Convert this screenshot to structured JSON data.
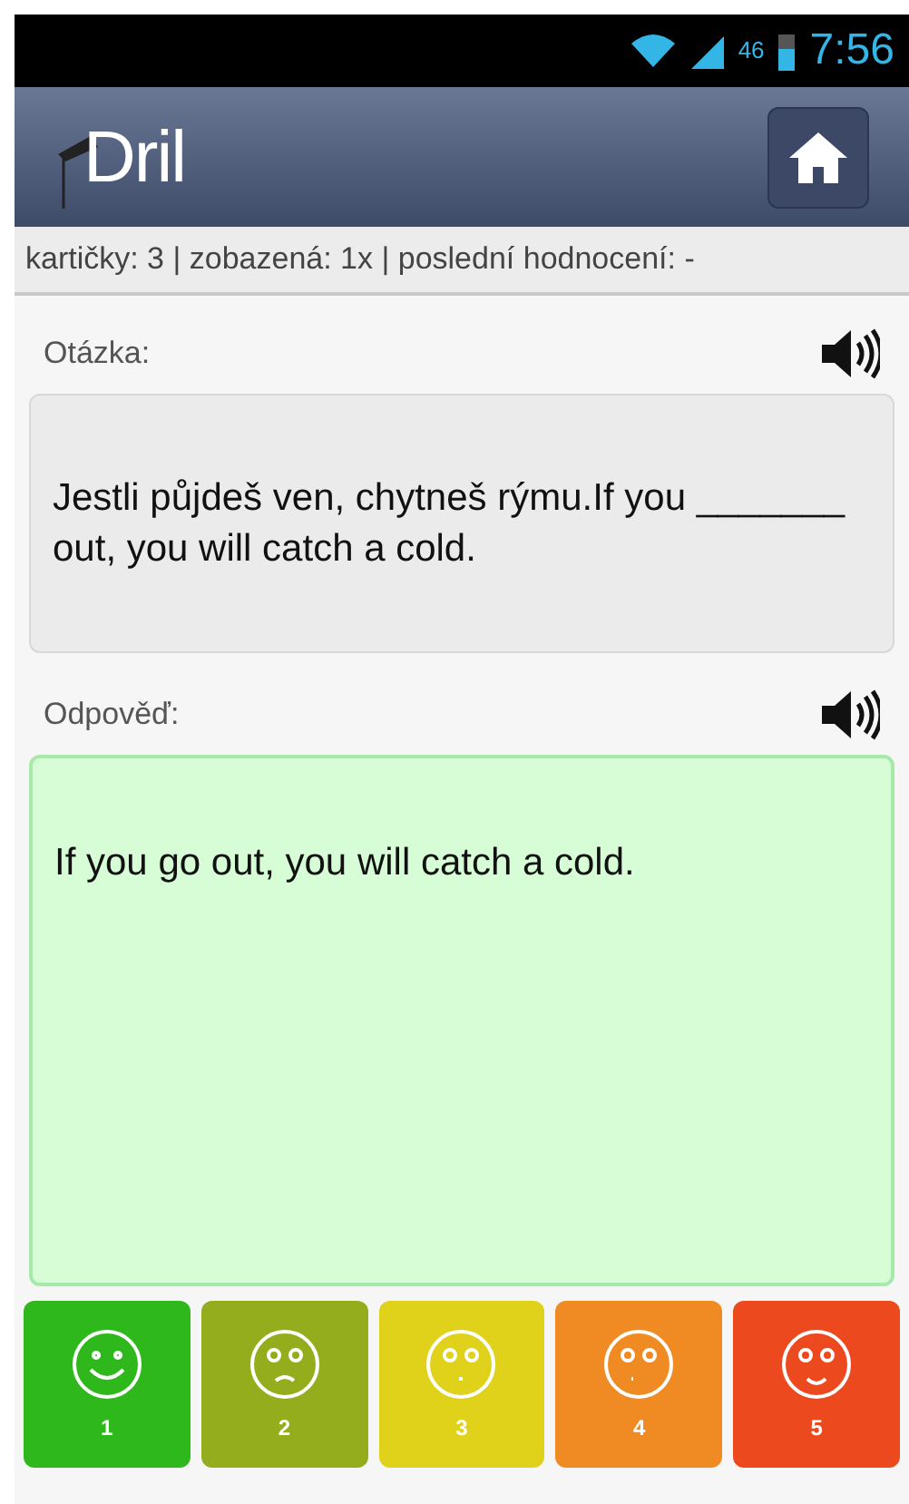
{
  "status_bar": {
    "network": "46",
    "time": "7:56"
  },
  "header": {
    "logo": "Dril"
  },
  "info_bar": "kartičky: 3 | zobazená: 1x | poslední hodnocení: -",
  "question": {
    "label": "Otázka:",
    "text": "Jestli půjdeš ven, chytneš rýmu.If you _______ out, you will catch a cold."
  },
  "answer": {
    "label": "Odpověď:",
    "text": "If you go out, you will catch a cold."
  },
  "ratings": [
    {
      "label": "1",
      "color": "#2fb81c"
    },
    {
      "label": "2",
      "color": "#93ad1c"
    },
    {
      "label": "3",
      "color": "#e0d21a"
    },
    {
      "label": "4",
      "color": "#f08a22"
    },
    {
      "label": "5",
      "color": "#ec4a1e"
    }
  ]
}
